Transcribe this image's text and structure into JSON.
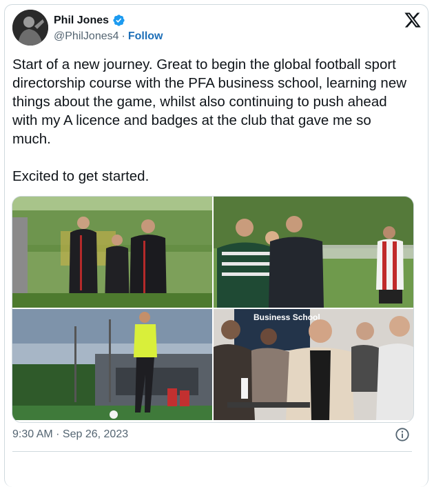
{
  "author": {
    "name": "Phil Jones",
    "handle": "@PhilJones4",
    "separator": "·",
    "follow_label": "Follow"
  },
  "tweet": {
    "text": "Start of a new journey. Great to begin the global football sport directorship course with the PFA business school, learning new things about the game, whilst also continuing to push ahead with my A licence and badges at the club that gave me so much.\n\nExcited to get started."
  },
  "photos": [
    {
      "icon": "photo-coaches-on-pitch"
    },
    {
      "icon": "photo-players-training"
    },
    {
      "icon": "photo-training-ground"
    },
    {
      "icon": "photo-business-school-class",
      "sign_text": "Business School"
    }
  ],
  "meta": {
    "timestamp": "9:30 AM · Sep 26, 2023"
  },
  "colors": {
    "verified": "#1d9bf0",
    "follow": "#1d6fb8",
    "muted": "#536471"
  }
}
